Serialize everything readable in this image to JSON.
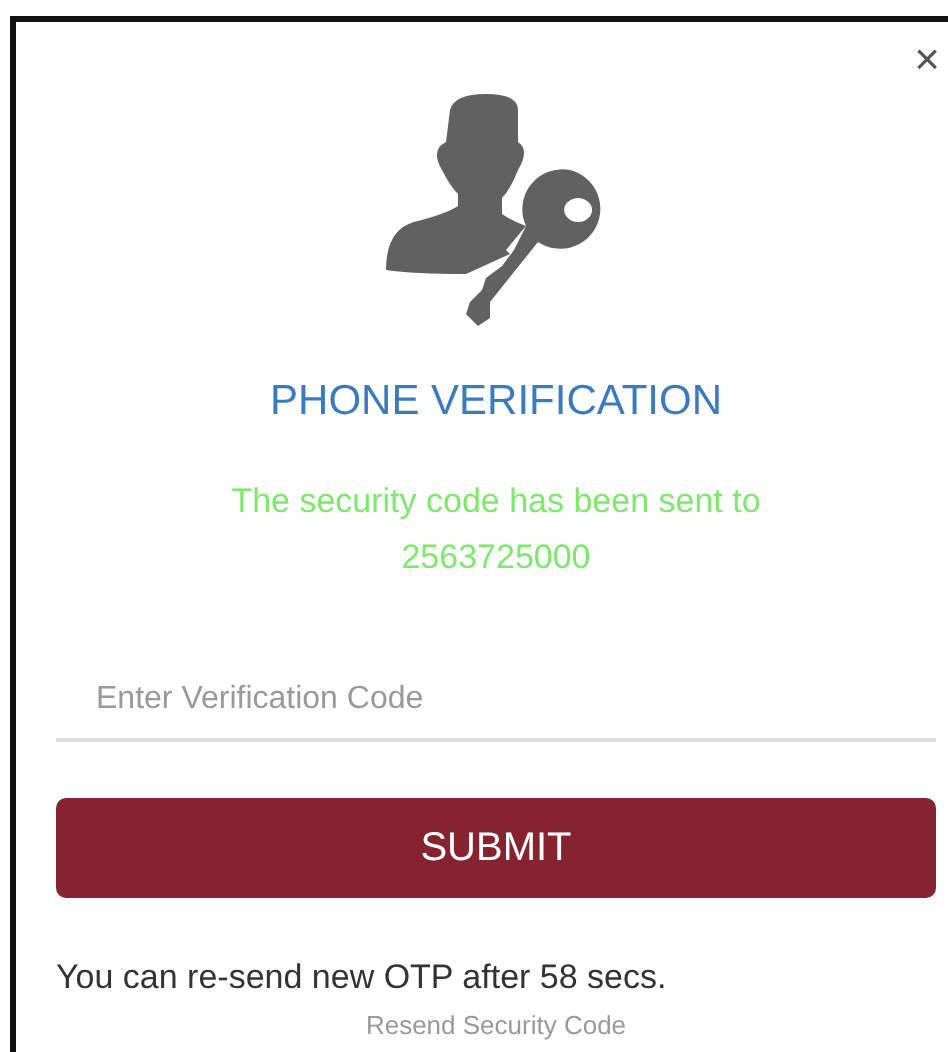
{
  "dialog": {
    "close": "×",
    "title": "PHONE VERIFICATION",
    "message": "The security code has been sent to 2563725000",
    "input": {
      "placeholder": "Enter Verification Code"
    },
    "submit": "SUBMIT",
    "timer_note": "You can re-send new OTP after 58 secs.",
    "resend_link": "Resend Security Code"
  }
}
